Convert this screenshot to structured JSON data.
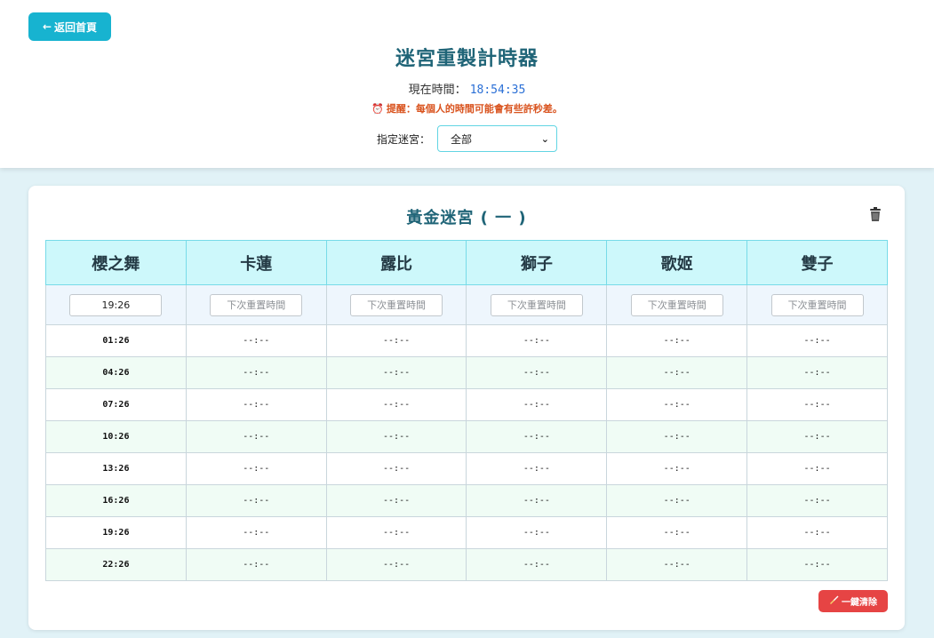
{
  "header": {
    "back_label": "返回首頁",
    "title": "迷宮重製計時器",
    "now_label": "現在時間：",
    "now_time": "18:54:35",
    "reminder": "提醒：每個人的時間可能會有些許秒差。",
    "maze_label": "指定迷宮：",
    "maze_selected": "全部"
  },
  "icons": {
    "back": "left-arrow-icon",
    "alarm": "alarm-clock-icon",
    "trash": "trash-icon",
    "broom": "broom-icon",
    "dropdown": "chevron-down-icon"
  },
  "colors": {
    "accent": "#17b3d0",
    "title": "#1f6477",
    "clock": "#2a6fd6",
    "warning": "#d9531e",
    "danger": "#e64444",
    "header_cells": "#cdf8fb"
  },
  "card": {
    "title": "黃金迷宮 ( 一 )",
    "columns": [
      "櫻之舞",
      "卡蓮",
      "露比",
      "獅子",
      "歌姬",
      "雙子"
    ],
    "inputs": [
      {
        "value": "19:26",
        "placeholder": "下次重置時間"
      },
      {
        "value": "",
        "placeholder": "下次重置時間"
      },
      {
        "value": "",
        "placeholder": "下次重置時間"
      },
      {
        "value": "",
        "placeholder": "下次重置時間"
      },
      {
        "value": "",
        "placeholder": "下次重置時間"
      },
      {
        "value": "",
        "placeholder": "下次重置時間"
      }
    ],
    "rows": [
      [
        "01:26",
        "--:--",
        "--:--",
        "--:--",
        "--:--",
        "--:--"
      ],
      [
        "04:26",
        "--:--",
        "--:--",
        "--:--",
        "--:--",
        "--:--"
      ],
      [
        "07:26",
        "--:--",
        "--:--",
        "--:--",
        "--:--",
        "--:--"
      ],
      [
        "10:26",
        "--:--",
        "--:--",
        "--:--",
        "--:--",
        "--:--"
      ],
      [
        "13:26",
        "--:--",
        "--:--",
        "--:--",
        "--:--",
        "--:--"
      ],
      [
        "16:26",
        "--:--",
        "--:--",
        "--:--",
        "--:--",
        "--:--"
      ],
      [
        "19:26",
        "--:--",
        "--:--",
        "--:--",
        "--:--",
        "--:--"
      ],
      [
        "22:26",
        "--:--",
        "--:--",
        "--:--",
        "--:--",
        "--:--"
      ]
    ],
    "clear_label": "一鍵清除"
  }
}
